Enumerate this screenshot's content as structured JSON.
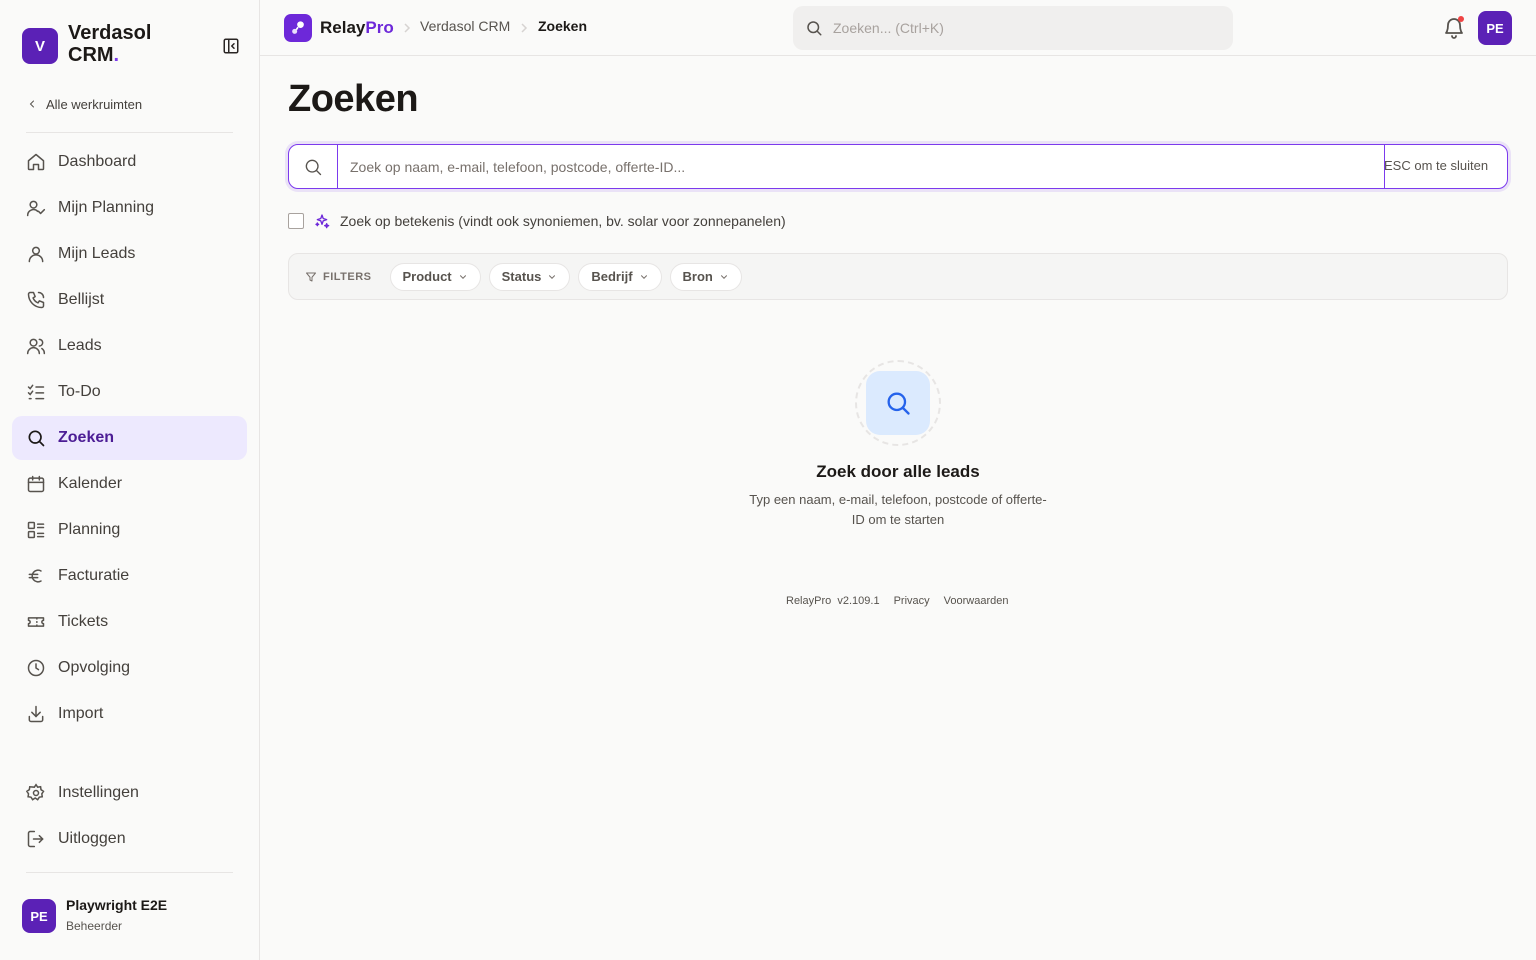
{
  "workspace": {
    "initial": "V",
    "name": "Verdasol CRM",
    "name_suffix": ".",
    "back_label": "Alle werkruimten"
  },
  "nav": {
    "items": [
      {
        "label": "Dashboard",
        "icon": "home-icon"
      },
      {
        "label": "Mijn Planning",
        "icon": "user-check-icon"
      },
      {
        "label": "Mijn Leads",
        "icon": "user-icon"
      },
      {
        "label": "Bellijst",
        "icon": "phone-icon"
      },
      {
        "label": "Leads",
        "icon": "users-icon"
      },
      {
        "label": "To-Do",
        "icon": "list-checks-icon"
      },
      {
        "label": "Zoeken",
        "icon": "search-icon",
        "active": true
      },
      {
        "label": "Kalender",
        "icon": "calendar-icon"
      },
      {
        "label": "Planning",
        "icon": "list-layout-icon"
      },
      {
        "label": "Facturatie",
        "icon": "euro-icon"
      },
      {
        "label": "Tickets",
        "icon": "ticket-icon"
      },
      {
        "label": "Opvolging",
        "icon": "clock-icon"
      },
      {
        "label": "Import",
        "icon": "download-icon"
      }
    ],
    "bottom": [
      {
        "label": "Instellingen",
        "icon": "gear-icon"
      },
      {
        "label": "Uitloggen",
        "icon": "logout-icon"
      }
    ]
  },
  "user": {
    "initials": "PE",
    "name": "Playwright E2E",
    "role": "Beheerder"
  },
  "topbar": {
    "brand_relay": "Relay",
    "brand_pro": "Pro",
    "breadcrumb": [
      "Verdasol CRM",
      "Zoeken"
    ],
    "search_placeholder": "Zoeken... (Ctrl+K)",
    "avatar_initials": "PE"
  },
  "page": {
    "title": "Zoeken",
    "search_placeholder": "Zoek op naam, e-mail, telefoon, postcode, offerte-ID...",
    "search_value": "",
    "esc_hint": "ESC om te sluiten",
    "semantic_label": "Zoek op betekenis (vindt ook synoniemen, bv. solar voor zonnepanelen)",
    "filters_label": "FILTERS",
    "filters": [
      "Product",
      "Status",
      "Bedrijf",
      "Bron"
    ],
    "empty_title": "Zoek door alle leads",
    "empty_subtitle": "Typ een naam, e-mail, telefoon, postcode of offerte-ID om te starten"
  },
  "footer": {
    "app": "RelayPro",
    "version": "v2.109.1",
    "privacy": "Privacy",
    "terms": "Voorwaarden"
  },
  "colors": {
    "accent": "#6d28d9",
    "active_bg": "#ede9fe",
    "notification": "#ef4444"
  }
}
